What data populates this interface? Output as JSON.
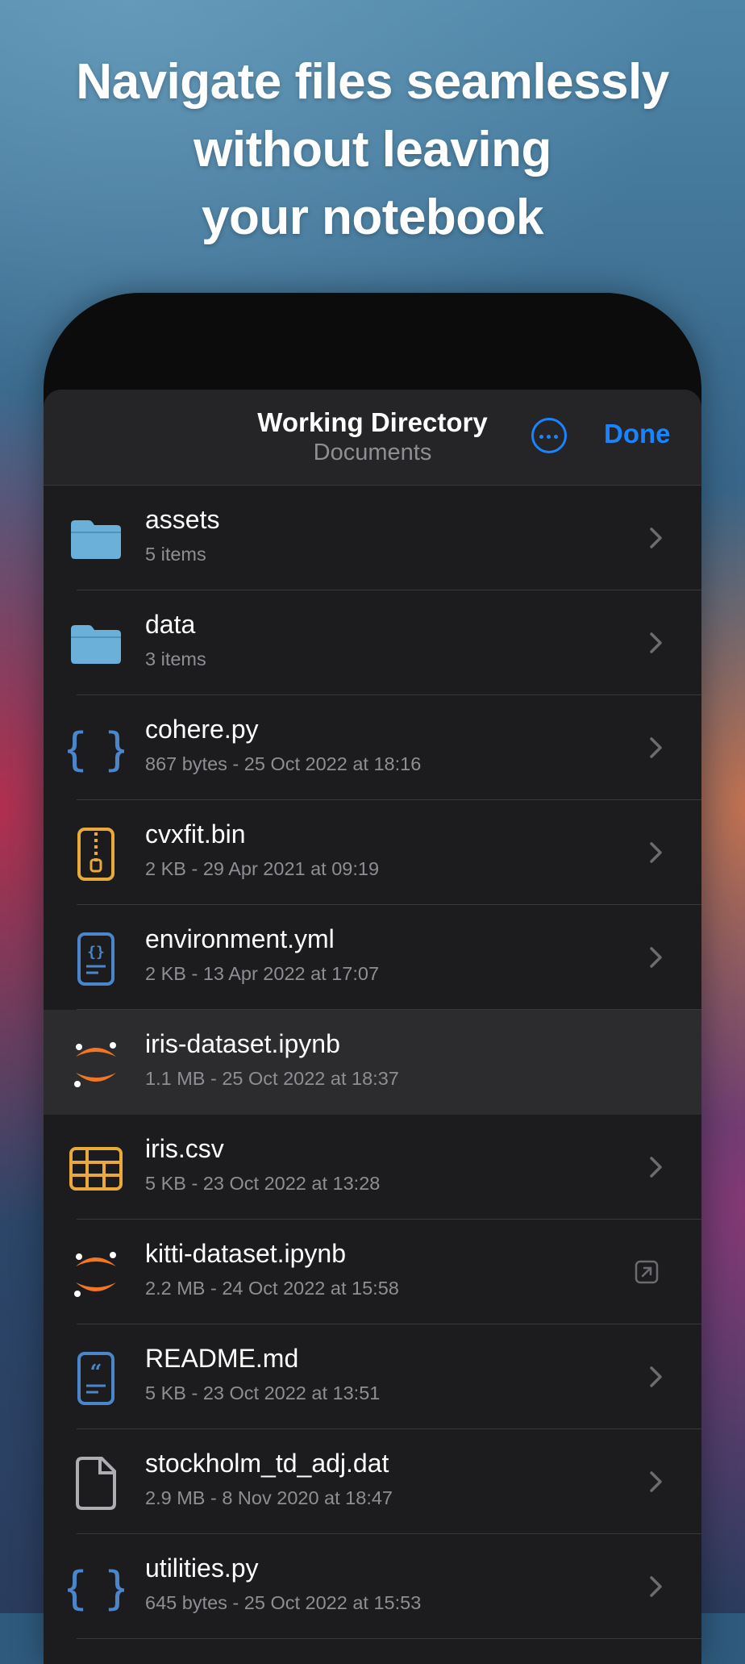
{
  "headline": {
    "line1": "Navigate files seamlessly",
    "line2": "without leaving",
    "line3": "your notebook"
  },
  "navbar": {
    "title": "Working Directory",
    "subtitle": "Documents",
    "more_icon": "ellipsis-circle-icon",
    "done_label": "Done"
  },
  "colors": {
    "accent": "#1a84ff",
    "folder": "#6ab0d8",
    "code_blue": "#4a86c9",
    "archive_orange": "#e9a93b",
    "jupyter_orange": "#f37626"
  },
  "files": [
    {
      "name": "assets",
      "meta": "5 items",
      "icon": "folder-icon",
      "accessory": "chevron-right-icon"
    },
    {
      "name": "data",
      "meta": "3 items",
      "icon": "folder-icon",
      "accessory": "chevron-right-icon"
    },
    {
      "name": "cohere.py",
      "meta": "867 bytes - 25 Oct 2022 at 18:16",
      "icon": "curly-braces-icon",
      "accessory": "chevron-right-icon"
    },
    {
      "name": "cvxfit.bin",
      "meta": "2 KB - 29 Apr 2021 at 09:19",
      "icon": "zip-archive-icon",
      "accessory": "chevron-right-icon"
    },
    {
      "name": "environment.yml",
      "meta": "2 KB - 13 Apr 2022 at 17:07",
      "icon": "config-document-icon",
      "accessory": "chevron-right-icon"
    },
    {
      "name": "iris-dataset.ipynb",
      "meta": "1.1 MB - 25 Oct 2022 at 18:37",
      "icon": "jupyter-icon",
      "accessory": "none",
      "selected": true
    },
    {
      "name": "iris.csv",
      "meta": "5 KB - 23 Oct 2022 at 13:28",
      "icon": "table-icon",
      "accessory": "chevron-right-icon"
    },
    {
      "name": "kitti-dataset.ipynb",
      "meta": "2.2 MB - 24 Oct 2022 at 15:58",
      "icon": "jupyter-icon",
      "accessory": "open-external-icon"
    },
    {
      "name": "README.md",
      "meta": "5 KB - 23 Oct 2022 at 13:51",
      "icon": "markdown-document-icon",
      "accessory": "chevron-right-icon"
    },
    {
      "name": "stockholm_td_adj.dat",
      "meta": "2.9 MB - 8 Nov 2020 at 18:47",
      "icon": "blank-document-icon",
      "accessory": "chevron-right-icon"
    },
    {
      "name": "utilities.py",
      "meta": "645 bytes - 25 Oct 2022 at 15:53",
      "icon": "curly-braces-icon",
      "accessory": "chevron-right-icon"
    }
  ]
}
